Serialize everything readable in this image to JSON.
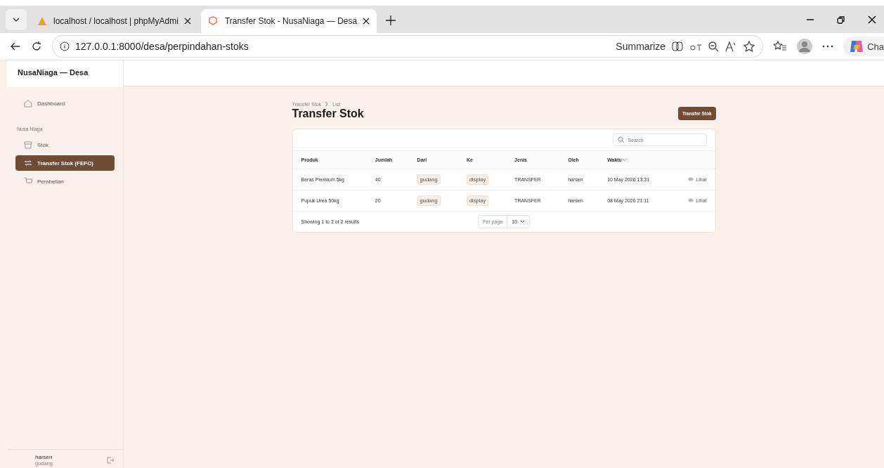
{
  "browser": {
    "tabs": [
      {
        "title": "localhost / localhost | phpMyAdmi",
        "selected": false
      },
      {
        "title": "Transfer Stok - NusaNiaga — Desa",
        "selected": true
      }
    ],
    "url": "127.0.0.1:8000/desa/perpindahan-stoks",
    "summarize": "Summarize",
    "copilot": "Cha"
  },
  "sidebar": {
    "brand": "NusaNiaga — Desa",
    "items": [
      {
        "label": "Dashboard",
        "kind": "item",
        "selected": false
      },
      {
        "label": "Nusa Niaga",
        "kind": "group"
      },
      {
        "label": "Stok",
        "kind": "item",
        "selected": false
      },
      {
        "label": "Transfer Stok (FEFO)",
        "kind": "item",
        "selected": true
      },
      {
        "label": "Pembelian",
        "kind": "item",
        "selected": false
      }
    ],
    "user": {
      "name": "harsen",
      "role": "gudang"
    }
  },
  "breadcrumbs": [
    "Transfer Stok",
    "List"
  ],
  "title": "Transfer Stok",
  "create_button": "Transfer Stok",
  "table": {
    "search_placeholder": "Search",
    "columns": [
      {
        "label": "Produk",
        "sorted": false
      },
      {
        "label": "Jumlah",
        "sorted": false
      },
      {
        "label": "Dari",
        "sorted": false
      },
      {
        "label": "Ke",
        "sorted": false
      },
      {
        "label": "Jenis",
        "sorted": false
      },
      {
        "label": "Oleh",
        "sorted": false
      },
      {
        "label": "Waktu",
        "sorted": true
      }
    ],
    "rows": [
      {
        "produk": "Beras Premium 5kg",
        "jumlah": "40",
        "dari": "gudang",
        "ke": "display",
        "jenis": "TRANSFER",
        "oleh": "harsen",
        "waktu": "10 May 2026 13:31",
        "action": "Lihat"
      },
      {
        "produk": "Pupuk Urea 50kg",
        "jumlah": "20",
        "dari": "gudang",
        "ke": "display",
        "jenis": "TRANSFER",
        "oleh": "harsen",
        "waktu": "08 May 2026 21:11",
        "action": "Lihat"
      }
    ],
    "summary": "Showing 1 to 2 of 2 results",
    "per_page_label": "Per page",
    "per_page": "10"
  }
}
